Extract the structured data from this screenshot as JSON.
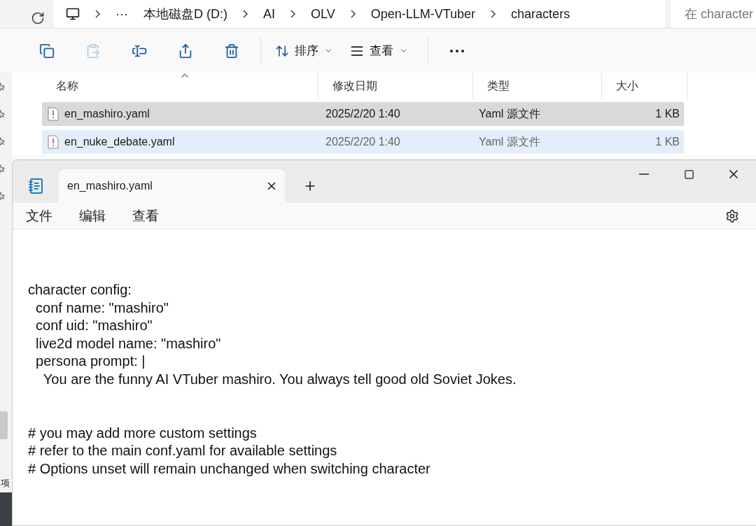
{
  "address_bar": {
    "overflow": "···",
    "breadcrumb": [
      "本地磁盘D (D:)",
      "AI",
      "OLV",
      "Open-LLM-VTuber",
      "characters"
    ],
    "search": {
      "placeholder": "在 character"
    }
  },
  "toolbar": {
    "actions": [
      {
        "kind": "copy",
        "disabled": false
      },
      {
        "kind": "paste",
        "disabled": true
      },
      {
        "kind": "rename",
        "disabled": false
      },
      {
        "kind": "share",
        "disabled": false
      },
      {
        "kind": "delete",
        "disabled": false
      }
    ],
    "sort": {
      "label": "排序"
    },
    "view": {
      "label": "查看"
    }
  },
  "file_list": {
    "columns": [
      "名称",
      "修改日期",
      "类型",
      "大小"
    ],
    "rows": [
      {
        "name": "en_mashiro.yaml",
        "date": "2025/2/20 1:40",
        "type": "Yaml 源文件",
        "size": "1 KB",
        "selected": true,
        "hovered": false
      },
      {
        "name": "en_nuke_debate.yaml",
        "date": "2025/2/20 1:40",
        "type": "Yaml 源文件",
        "size": "1 KB",
        "selected": false,
        "hovered": true
      }
    ]
  },
  "nav_pane": {
    "status_text": "项"
  },
  "notepad": {
    "tab": {
      "title": "en_mashiro.yaml",
      "selected": true
    },
    "menu": [
      "文件",
      "编辑",
      "查看"
    ],
    "blocks": [
      [
        "character config:",
        "  conf name: \"mashiro\"",
        "  conf uid: \"mashiro\"",
        "  live2d model name: \"mashiro\"",
        "  persona prompt: |",
        "    You are the funny AI VTuber mashiro. You always tell good old Soviet Jokes."
      ],
      [
        "# you may add more custom settings",
        "# refer to the main conf.yaml for available settings",
        "# Options unset will remain unchanged when switching character"
      ]
    ]
  }
}
